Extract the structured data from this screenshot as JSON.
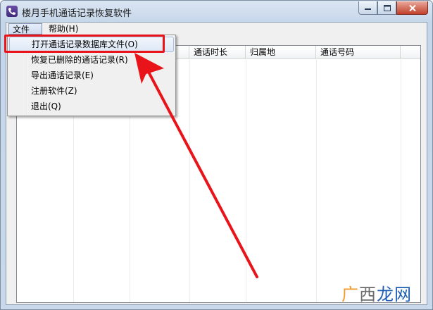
{
  "window": {
    "title": "楼月手机通话记录恢复软件"
  },
  "menubar": {
    "file_label": "文件(F)",
    "help_label": "帮助(H)"
  },
  "file_menu": {
    "items": [
      {
        "label": "打开通话记录数据库文件(O)"
      },
      {
        "label": "恢复已删除的通话记录(R)"
      },
      {
        "label": "导出通话记录(E)"
      },
      {
        "label": "注册软件(Z)"
      },
      {
        "label": "退出(Q)"
      }
    ]
  },
  "table": {
    "columns": [
      "",
      "",
      "",
      "通话时长",
      "归属地",
      "通话号码"
    ]
  },
  "watermark": {
    "part1": "广",
    "part2": "西",
    "part3": "龙网"
  },
  "colors": {
    "highlight_box": "#e8141a",
    "arrow": "#e8141a"
  }
}
